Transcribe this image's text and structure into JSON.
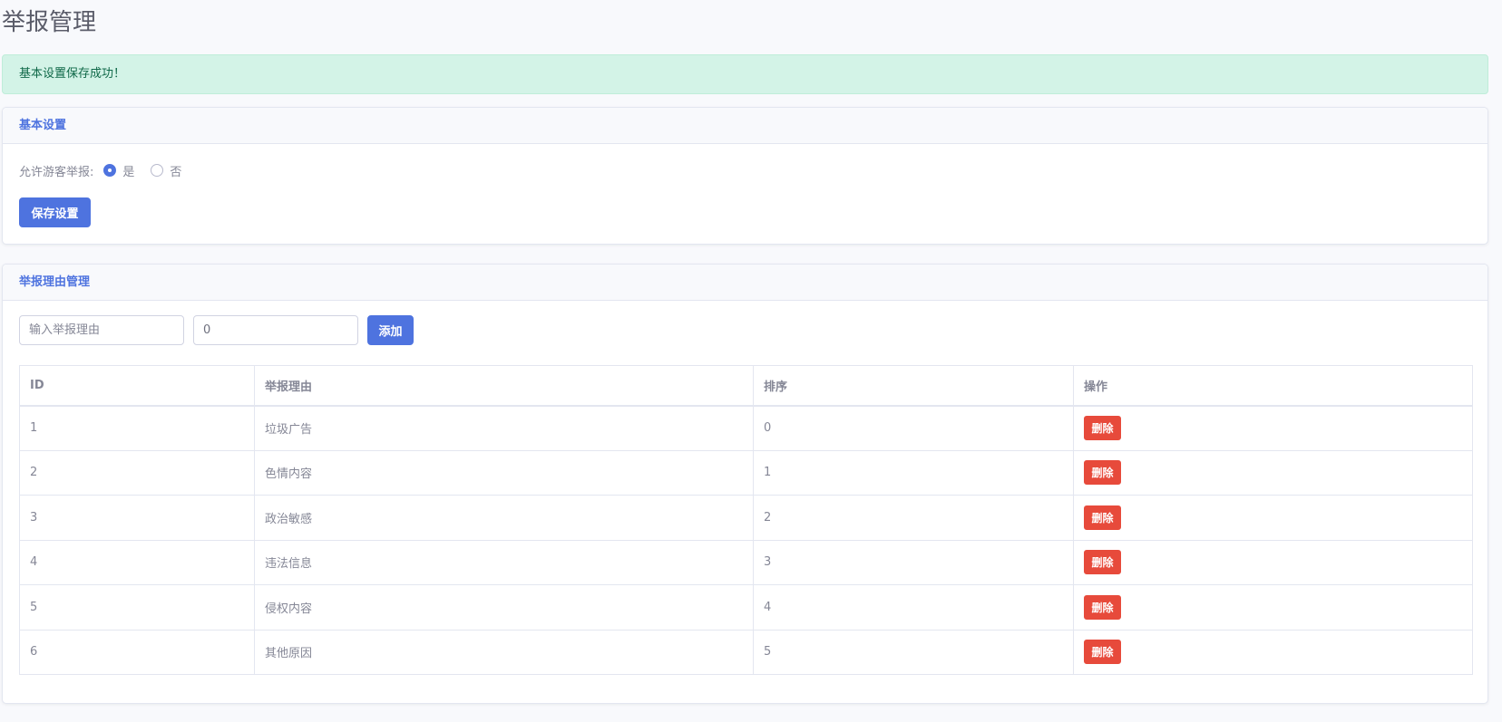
{
  "page": {
    "title": "举报管理"
  },
  "alert": {
    "message": "基本设置保存成功！"
  },
  "basic_settings": {
    "header": "基本设置",
    "guest_report_label": "允许游客举报:",
    "options": [
      {
        "label": "是",
        "checked": true
      },
      {
        "label": "否",
        "checked": false
      }
    ],
    "save_label": "保存设置"
  },
  "reasons": {
    "header": "举报理由管理",
    "reason_input": {
      "placeholder": "输入举报理由",
      "value": ""
    },
    "sort_input": {
      "placeholder": "",
      "value": "0"
    },
    "add_label": "添加",
    "table": {
      "columns": [
        "ID",
        "举报理由",
        "排序",
        "操作"
      ],
      "rows": [
        {
          "id": "1",
          "reason": "垃圾广告",
          "sort": "0",
          "action": "删除"
        },
        {
          "id": "2",
          "reason": "色情内容",
          "sort": "1",
          "action": "删除"
        },
        {
          "id": "3",
          "reason": "政治敏感",
          "sort": "2",
          "action": "删除"
        },
        {
          "id": "4",
          "reason": "违法信息",
          "sort": "3",
          "action": "删除"
        },
        {
          "id": "5",
          "reason": "侵权内容",
          "sort": "4",
          "action": "删除"
        },
        {
          "id": "6",
          "reason": "其他原因",
          "sort": "5",
          "action": "删除"
        }
      ]
    }
  },
  "colors": {
    "primary": "#4e73df",
    "danger": "#e74a3b",
    "success_bg": "#d3f3e7",
    "success_text": "#0f6848"
  }
}
